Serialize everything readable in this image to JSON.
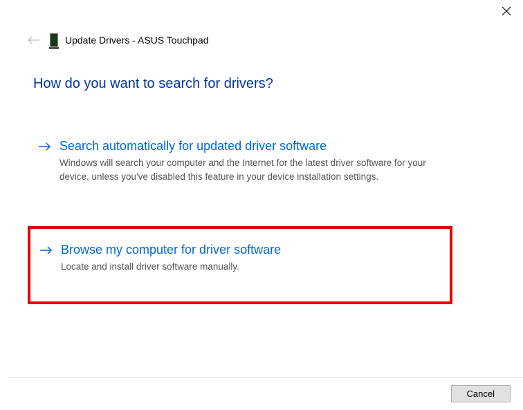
{
  "window": {
    "title": "Update Drivers - ASUS Touchpad"
  },
  "heading": "How do you want to search for drivers?",
  "options": {
    "auto": {
      "title": "Search automatically for updated driver software",
      "desc": "Windows will search your computer and the Internet for the latest driver software for your device, unless you've disabled this feature in your device installation settings."
    },
    "browse": {
      "title": "Browse my computer for driver software",
      "desc": "Locate and install driver software manually."
    }
  },
  "footer": {
    "cancel": "Cancel"
  }
}
